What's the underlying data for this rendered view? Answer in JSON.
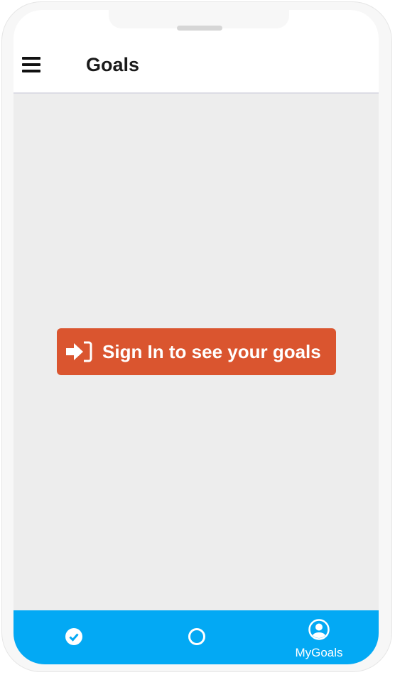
{
  "header": {
    "title": "Goals",
    "menu_icon": "hamburger-menu-icon"
  },
  "main": {
    "signin_label": "Sign In to see your goals",
    "signin_icon": "sign-in-icon"
  },
  "colors": {
    "accent": "#da552f",
    "tabbar": "#03a9f4",
    "background": "#ededed"
  },
  "tabbar": {
    "tabs": [
      {
        "icon": "check-circle-icon",
        "label": ""
      },
      {
        "icon": "circle-outline-icon",
        "label": ""
      },
      {
        "icon": "user-circle-icon",
        "label": "MyGoals"
      }
    ]
  }
}
